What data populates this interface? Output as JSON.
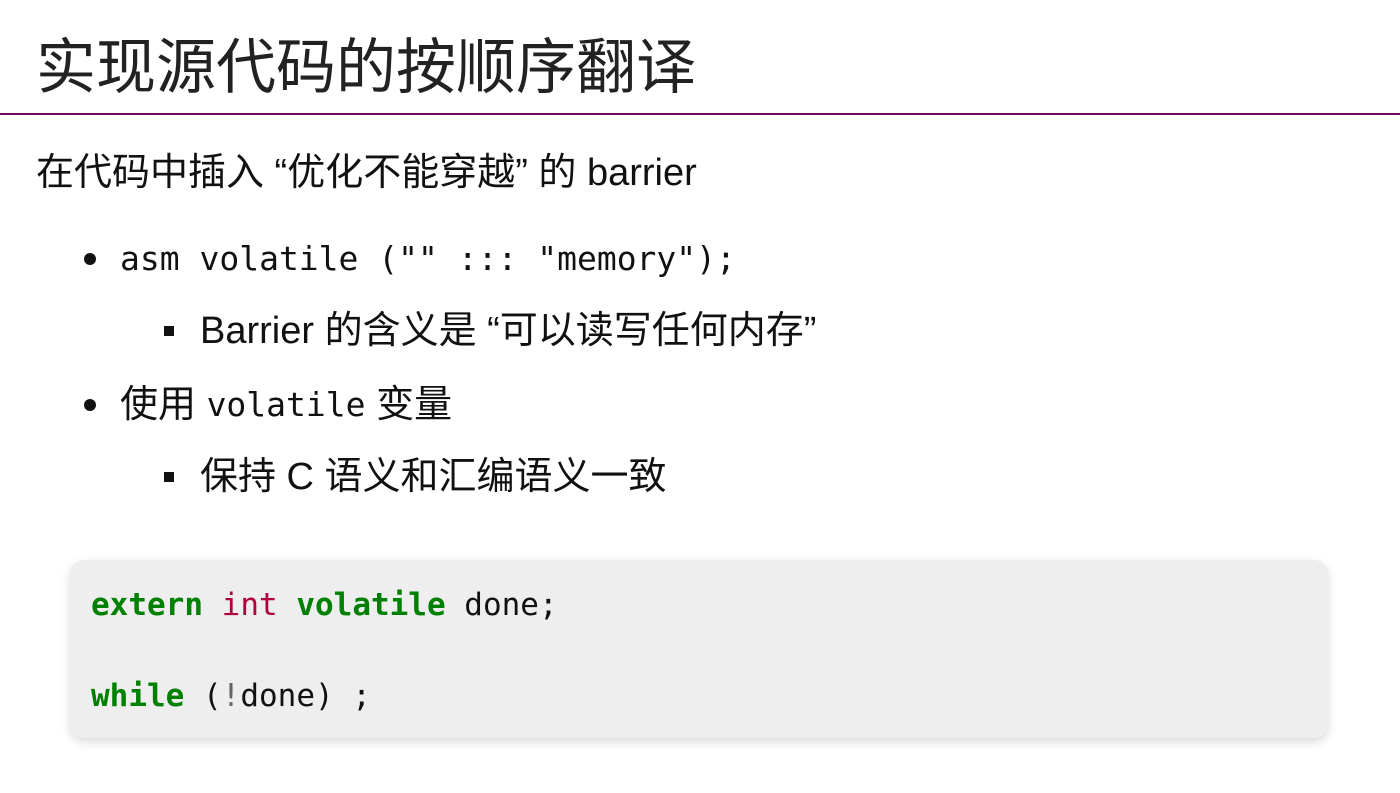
{
  "title": "实现源代码的按顺序翻译",
  "lead": "在代码中插入 “优化不能穿越” 的 barrier",
  "bullets": [
    {
      "code": "asm volatile (\"\" ::: \"memory\");",
      "sub": "Barrier 的含义是 “可以读写任何内存”"
    },
    {
      "text_before": "使用 ",
      "code": "volatile",
      "text_after": " 变量",
      "sub": "保持 C 语义和汇编语义一致"
    }
  ],
  "code_block": {
    "line1": {
      "kw1": "extern",
      "type": "int",
      "kw2": "volatile",
      "rest": " done;"
    },
    "line2": {
      "kw": "while",
      "open": " (",
      "bang": "!",
      "rest": "done) ;"
    }
  },
  "colors": {
    "rule": "#6b0a5e",
    "keyword": "#008000",
    "type": "#b00040",
    "code_bg": "#eeeeee"
  }
}
